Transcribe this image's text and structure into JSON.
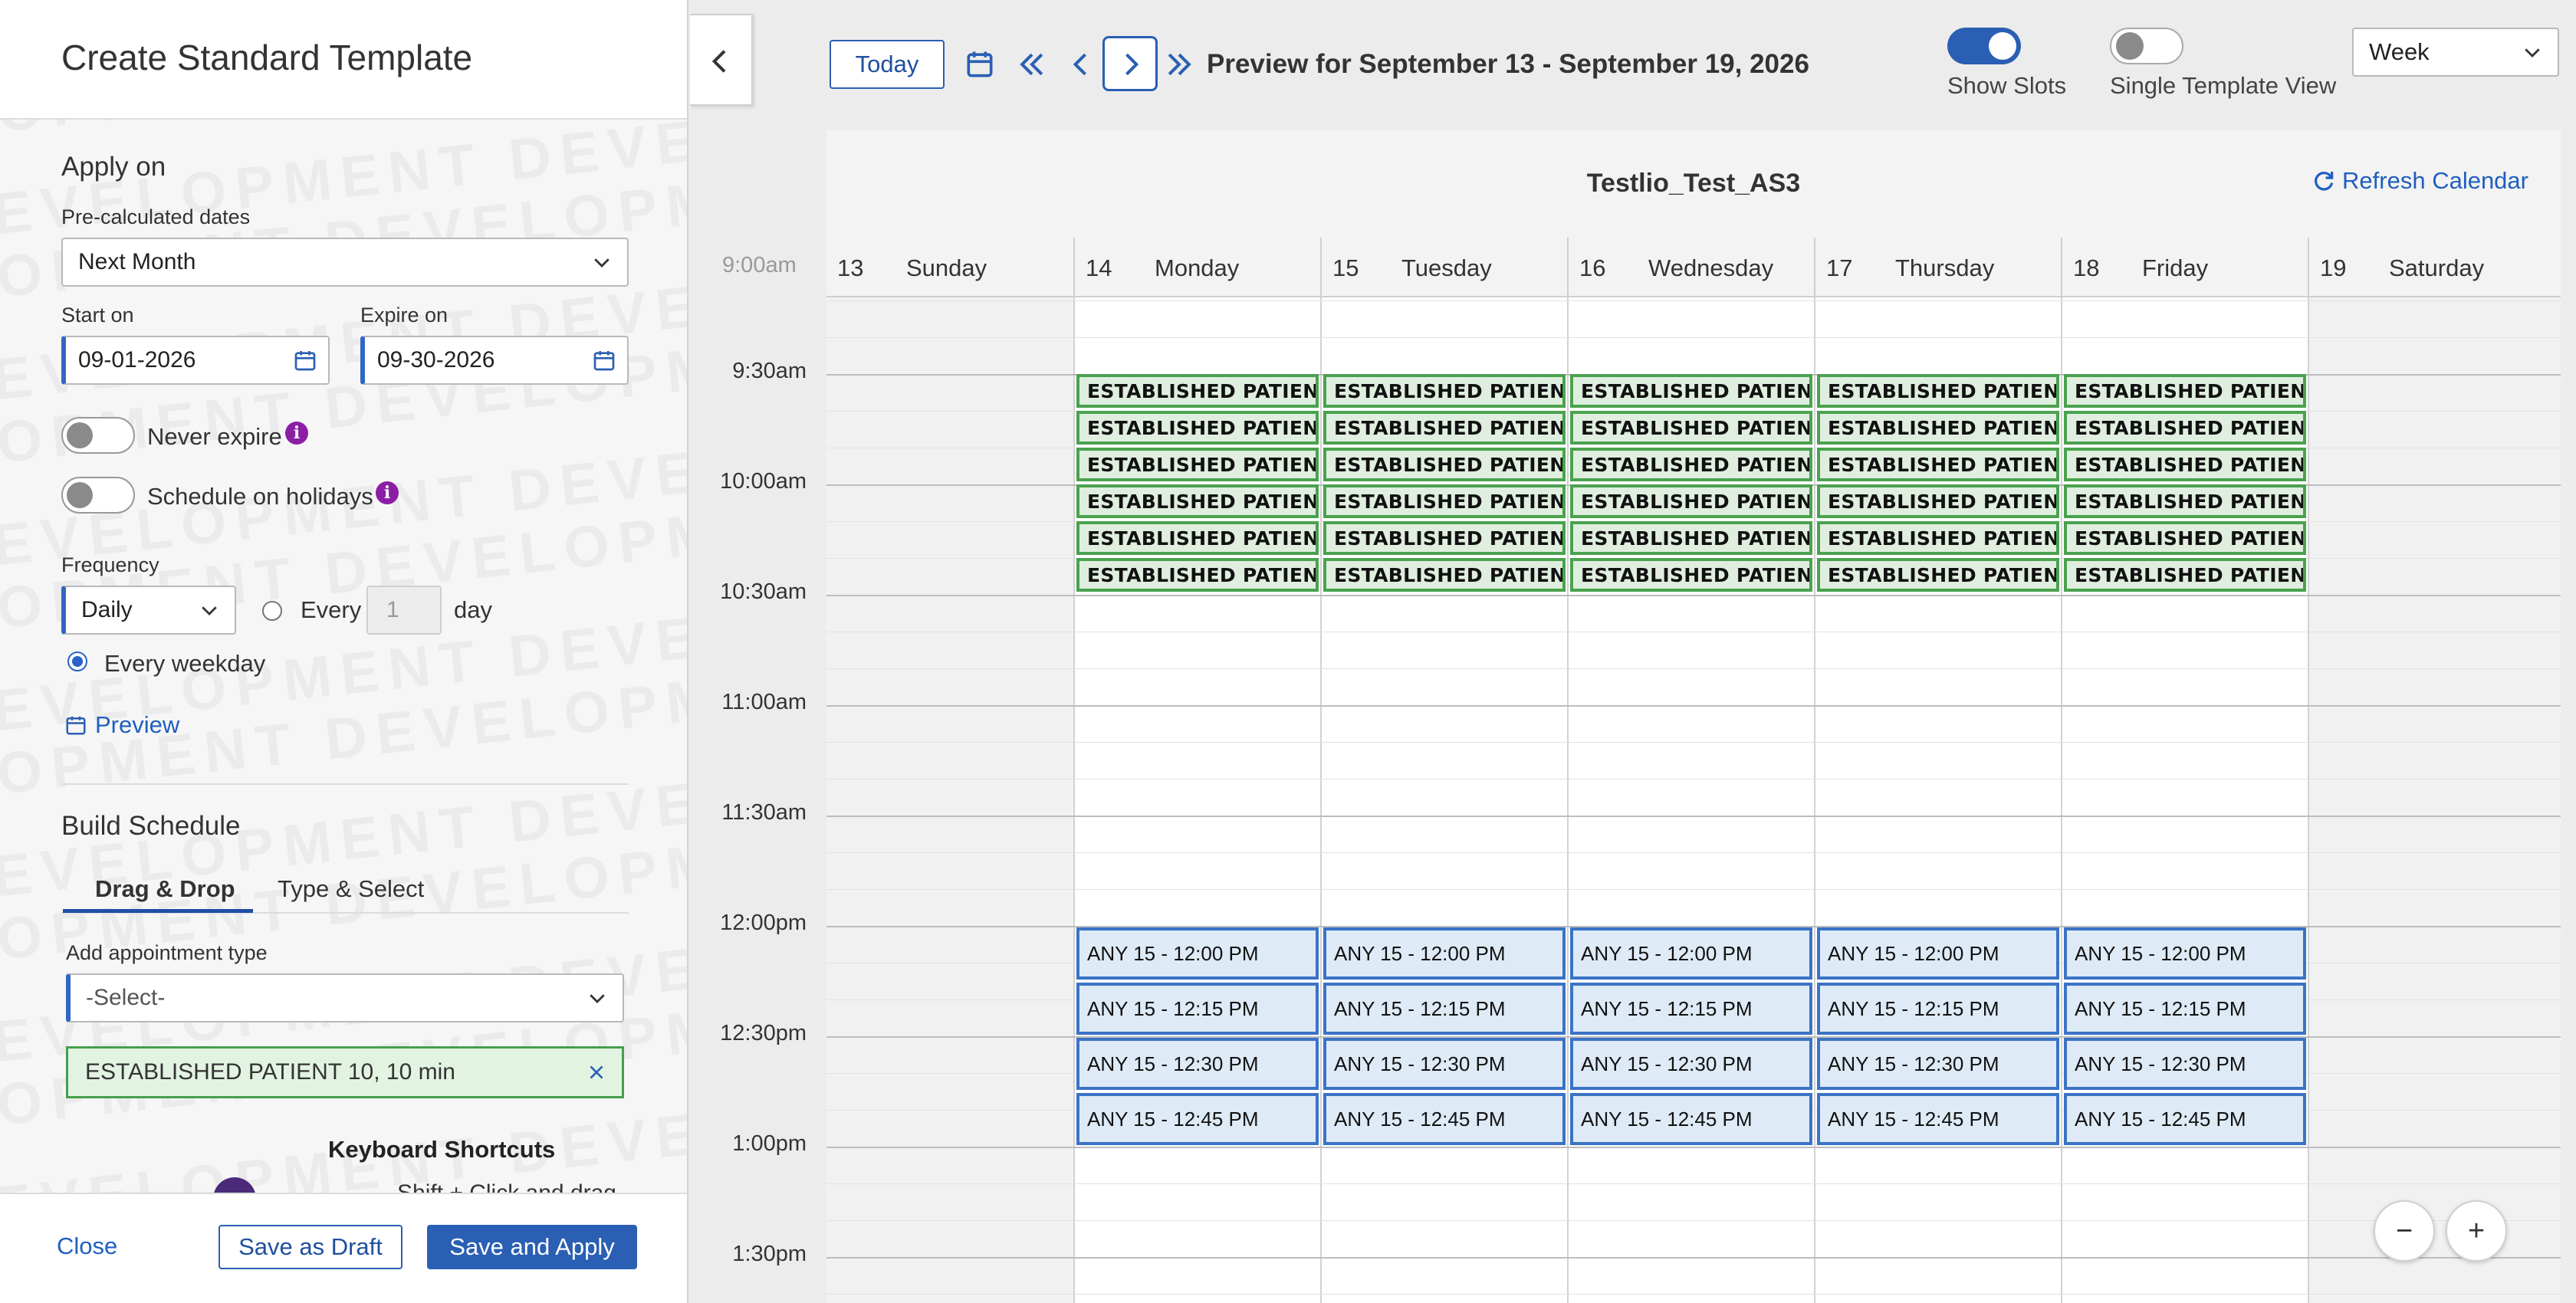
{
  "panel": {
    "title": "Create Standard Template",
    "watermark": "DEVELOPMENT",
    "apply_on": {
      "title": "Apply on",
      "precalc_label": "Pre-calculated dates",
      "precalc_value": "Next Month",
      "start_label": "Start on",
      "start_value": "09-01-2026",
      "expire_label": "Expire on",
      "expire_value": "09-30-2026",
      "never_expire_label": "Never expire",
      "holidays_label": "Schedule on holidays",
      "frequency_label": "Frequency",
      "frequency_value": "Daily",
      "every_label": "Every",
      "every_value": "1",
      "day_label": "day",
      "every_weekday_label": "Every weekday",
      "preview_link": "Preview"
    },
    "build": {
      "title": "Build Schedule",
      "tabs": [
        "Drag & Drop",
        "Type & Select"
      ],
      "add_type_label": "Add appointment type",
      "add_type_placeholder": "-Select-",
      "selected_type": "ESTABLISHED PATIENT 10, 10 min",
      "kb_title": "Keyboard Shortcuts",
      "kb_line": "Shift + Click and drag"
    },
    "footer": {
      "close": "Close",
      "save_draft": "Save as Draft",
      "save_apply": "Save and Apply"
    }
  },
  "toolbar": {
    "today": "Today",
    "preview_range": "Preview for September 13 - September 19, 2026",
    "show_slots": "Show Slots",
    "single_view": "Single Template View",
    "view": "Week"
  },
  "calendar": {
    "name": "Testlio_Test_AS3",
    "refresh": "Refresh Calendar",
    "days": [
      {
        "num": "13",
        "name": "Sunday"
      },
      {
        "num": "14",
        "name": "Monday"
      },
      {
        "num": "15",
        "name": "Tuesday"
      },
      {
        "num": "16",
        "name": "Wednesday"
      },
      {
        "num": "17",
        "name": "Thursday"
      },
      {
        "num": "18",
        "name": "Friday"
      },
      {
        "num": "19",
        "name": "Saturday"
      }
    ],
    "partial_time": "9:00am",
    "times": [
      "9:30am",
      "10:00am",
      "10:30am",
      "11:00am",
      "11:30am",
      "12:00pm",
      "12:30pm",
      "1:00pm",
      "1:30pm"
    ],
    "established_slot_label": "ESTABLISHED PATIEN…",
    "any_slots": [
      "ANY 15 - 12:00 PM",
      "ANY 15 - 12:15 PM",
      "ANY 15 - 12:30 PM",
      "ANY 15 - 12:45 PM"
    ],
    "colors": {
      "established": "#4aa24e",
      "any": "#3b73c6"
    }
  },
  "zoom": {
    "out": "−",
    "in": "+"
  }
}
